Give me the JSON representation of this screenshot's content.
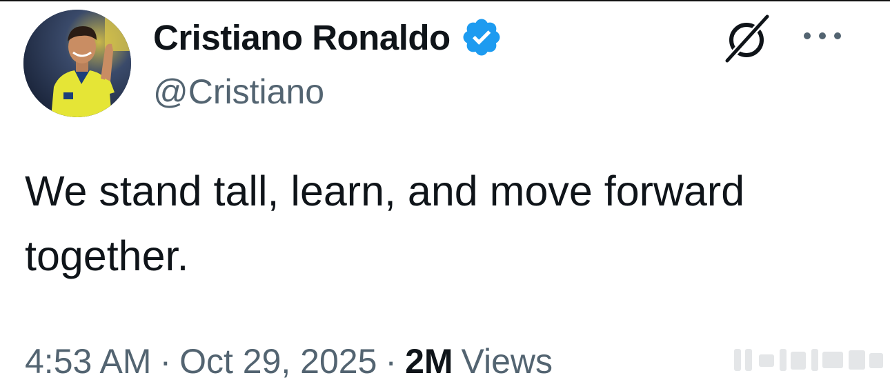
{
  "author": {
    "display_name": "Cristiano Ronaldo",
    "handle": "@Cristiano",
    "verified": true,
    "verified_color": "#1d9bf0",
    "avatar_icon": "profile-photo"
  },
  "actions": {
    "grok_icon": "grok-icon",
    "more_icon": "more-options-icon"
  },
  "tweet": {
    "text": "We stand tall, learn, and move forward together."
  },
  "meta": {
    "time": "4:53 AM",
    "separator": "·",
    "date": "Oct 29, 2025",
    "views_count": "2M",
    "views_label": "Views"
  },
  "colors": {
    "text_primary": "#0f1419",
    "text_secondary": "#536471",
    "accent": "#1d9bf0"
  }
}
